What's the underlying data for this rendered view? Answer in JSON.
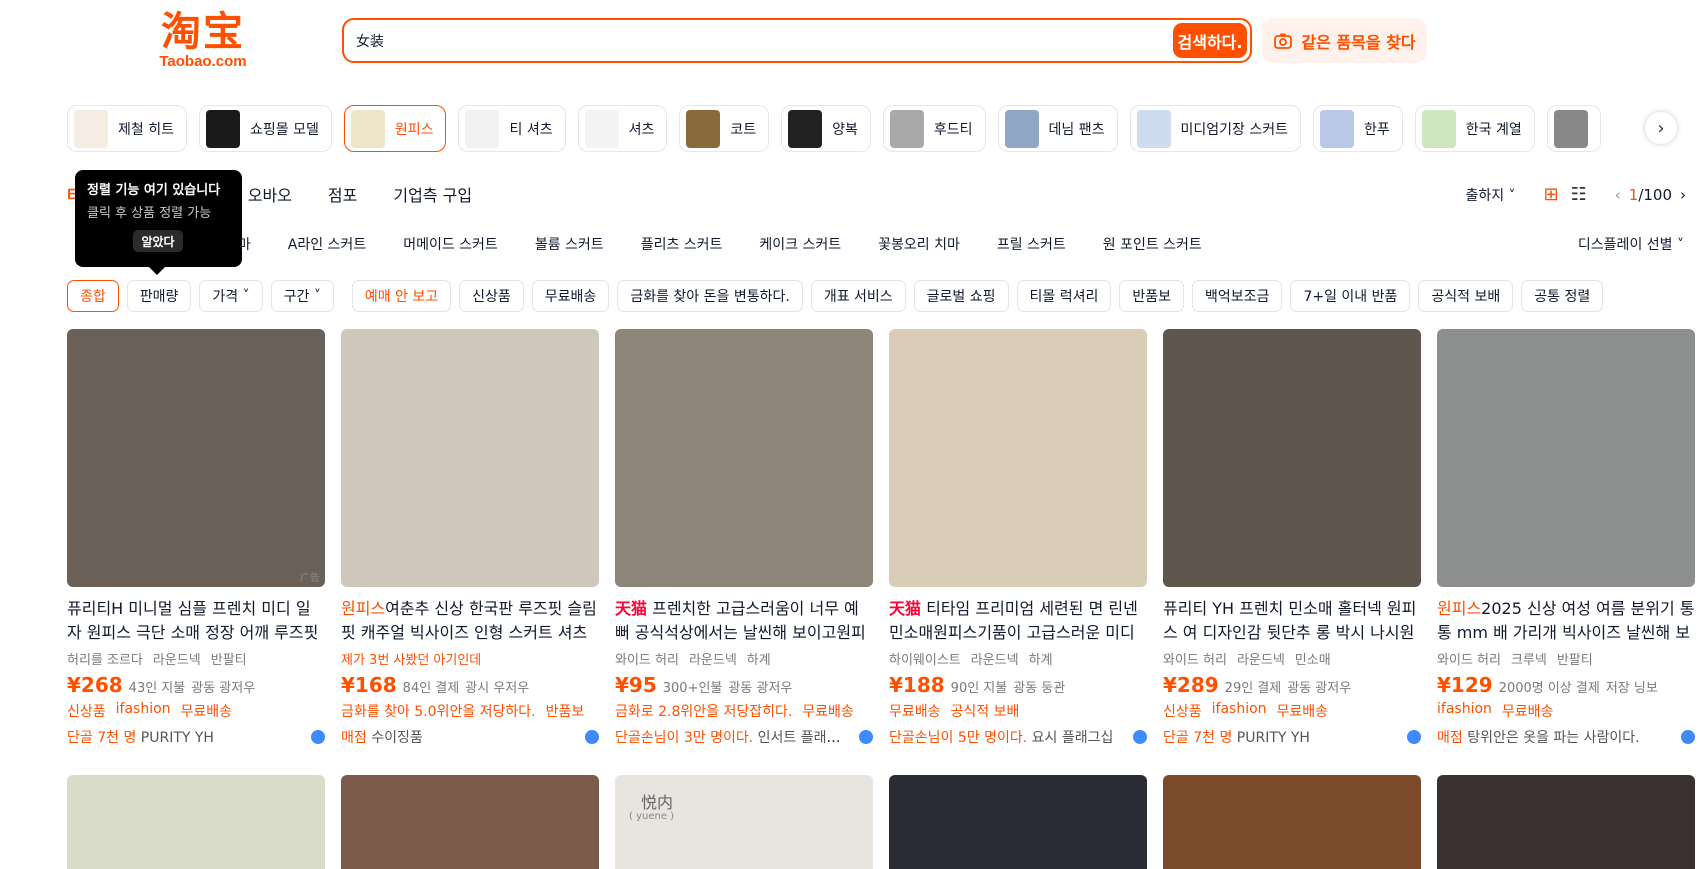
{
  "header": {
    "logo_cn": "淘宝",
    "logo_en": "Taobao.com",
    "search_value": "女装",
    "search_button": "검색하다.",
    "image_search": "같은 품목을 찾다"
  },
  "categories": [
    {
      "label": "제철 히트",
      "color": "#f5ece4"
    },
    {
      "label": "쇼핑몰 모델",
      "color": "#1a1a1a"
    },
    {
      "label": "원피스",
      "color": "#efe6c9"
    },
    {
      "label": "티 셔츠",
      "color": "#f2f2f2"
    },
    {
      "label": "셔츠",
      "color": "#fbfbfb"
    },
    {
      "label": "코트",
      "color": "#8a6a3c"
    },
    {
      "label": "양복",
      "color": "#222222"
    },
    {
      "label": "후드티",
      "color": "#a9a9a9"
    },
    {
      "label": "데님 팬츠",
      "color": "#8fa7c4"
    },
    {
      "label": "미디엄기장 스커트",
      "color": "#cfdcef"
    },
    {
      "label": "한푸",
      "color": "#b8c8e6"
    },
    {
      "label": "한국 계열",
      "color": "#cfe6c0"
    }
  ],
  "tabs": {
    "t0": "타",
    "t1": "오바오",
    "t2": "점포",
    "t3": "기업측 구입"
  },
  "tooltip": {
    "title": "정렬 기능 여기 있습니다",
    "sub": "클릭 후 상품 정렬 가능",
    "button": "알았다"
  },
  "sort_right": {
    "ship_from": "출하지",
    "page_current": "1",
    "page_total": "/100"
  },
  "styles": [
    "치마",
    "A라인 스커트",
    "머메이드 스커트",
    "볼륨 스커트",
    "플리츠 스커트",
    "케이크 스커트",
    "꽃봉오리 치마",
    "프릴 스커트",
    "원 포인트 스커트"
  ],
  "display_select": "디스플레이 선별",
  "filters": {
    "general": "종합",
    "sales": "판매량",
    "price": "가격",
    "range": "구간",
    "preorder": "예매 안 보고",
    "new": "신상품",
    "free_ship": "무료배송",
    "fx": "금화를 찾아 돈을 변통하다.",
    "open_service": "개표 서비스",
    "global": "글로벌 쇼핑",
    "tmall_luxury": "티몰 럭셔리",
    "return": "반품보",
    "subsidy": "백억보조금",
    "seven_day": "7+일 이내 반품",
    "official": "공식적 보배",
    "common_sort": "공통 정렬"
  },
  "products": [
    {
      "img_color": "#6b6158",
      "ad": "广告",
      "pre": "",
      "title": "퓨리티H 미니멀 심플 프렌치 미디 일자 원피스 극단 소매 정장 어깨 루즈핏",
      "tags": [
        "허리를 조르다",
        "라운드넥",
        "반팔티"
      ],
      "tags_orange": false,
      "price": "¥268",
      "sold": "43인 지불",
      "loc": "광동 광저우",
      "promo": [
        "신상품",
        "ifashion",
        "무료배송"
      ],
      "shop_prefix": "단골 7천 명",
      "shop_name": "PURITY YH"
    },
    {
      "img_color": "#cfc7bc",
      "ad": "",
      "pre": "원피스",
      "title": "여춘추 신상 한국판 루즈핏 슬림핏 캐주얼 빅사이즈 인형 스커트 셔츠",
      "tags": [
        "제가 3번 사봤던 아기인데"
      ],
      "tags_orange": true,
      "price": "¥168",
      "sold": "84인 결제",
      "loc": "광시 우저우",
      "promo": [
        "금화를 찾아 5.0위안을 저당하다.",
        "반품보"
      ],
      "shop_prefix": "매점",
      "shop_name": "수이징품"
    },
    {
      "img_color": "#8e857a",
      "ad": "",
      "pre": "天猫",
      "title": "프렌치한 고급스러움이 너무 예뻐 공식석상에서는 날씬해 보이고원피스",
      "tags": [
        "와이드 허리",
        "라운드넥",
        "하계"
      ],
      "tags_orange": false,
      "price": "¥95",
      "sold": "300+인불",
      "loc": "광동 광저우",
      "promo": [
        "금화로 2.8위안을 저당잡히다.",
        "무료배송"
      ],
      "shop_prefix": "단골손님이 3만 명이다.",
      "shop_name": "인서트 플래그십"
    },
    {
      "img_color": "#d9cdb8",
      "ad": "",
      "pre": "天猫",
      "title": "티타임 프리미엄 세련된 면 린넨 민소매원피스기품이 고급스러운 미디",
      "tags": [
        "하이웨이스트",
        "라운드넥",
        "하계"
      ],
      "tags_orange": false,
      "price": "¥188",
      "sold": "90인 지불",
      "loc": "광동 둥관",
      "promo": [
        "무료배송",
        "공식적 보배"
      ],
      "shop_prefix": "단골손님이 5만 명이다.",
      "shop_name": "요시 플래그십"
    },
    {
      "img_color": "#5e554c",
      "ad": "",
      "pre": "",
      "title": "퓨리티 YH 프렌치 민소매 홀터넥 원피스 여 디자인감 뒷단추 롱 박시 나시원피스",
      "tags": [
        "와이드 허리",
        "라운드넥",
        "민소매"
      ],
      "tags_orange": false,
      "price": "¥289",
      "sold": "29인 결제",
      "loc": "광동 광저우",
      "promo": [
        "신상품",
        "ifashion",
        "무료배송"
      ],
      "shop_prefix": "단골 7천 명",
      "shop_name": "PURITY YH"
    },
    {
      "img_color": "#8d8e8e",
      "ad": "",
      "pre": "원피스",
      "title": "2025 신상 여성 여름 분위기 통통 mm 배 가리개 빅사이즈 날씬해 보이는",
      "tags": [
        "와이드 허리",
        "크루넥",
        "반팔티"
      ],
      "tags_orange": false,
      "price": "¥129",
      "sold": "2000명 이상 결제",
      "loc": "저장 닝보",
      "promo": [
        "ifashion",
        "무료배송"
      ],
      "shop_prefix": "매점",
      "shop_name": "탕위안은 옷을 파는 사람이다."
    }
  ],
  "row2_colors": [
    "#d8dcc8",
    "#7a5a48",
    "#e8e4e0",
    "#2a2c35",
    "#7a4a2a",
    "#3a3030"
  ],
  "row2_texts": [
    "悦内",
    "( yuene )"
  ]
}
